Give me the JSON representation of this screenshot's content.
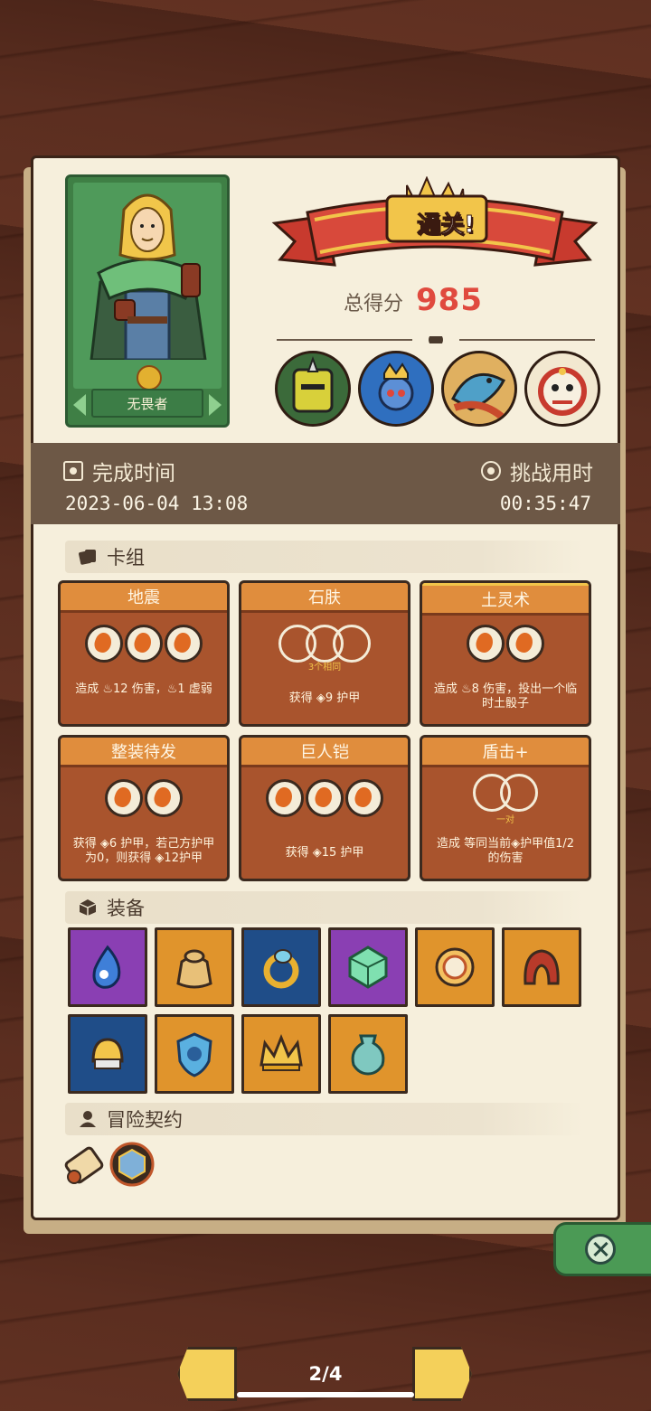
{
  "hero": {
    "name": "无畏者"
  },
  "result": {
    "banner": "通关!",
    "score_label": "总得分",
    "score_value": "985"
  },
  "time": {
    "complete_label": "完成时间",
    "complete_value": "2023-06-04  13:08",
    "challenge_label": "挑战用时",
    "challenge_value": "00:35:47"
  },
  "sections": {
    "deck": "卡组",
    "equipment": "装备",
    "contracts": "冒险契约"
  },
  "cards": [
    {
      "title": "地震",
      "orbs": 3,
      "sub": "",
      "desc": "造成 ♨12 伤害，♨1 虚弱"
    },
    {
      "title": "石肤",
      "orbs": 3,
      "sub": "3个相同",
      "desc": "获得 ◈9 护甲"
    },
    {
      "title": "土灵术",
      "orbs": 2,
      "sub": "",
      "desc": "造成 ♨8 伤害，投出一个临时土骰子"
    },
    {
      "title": "整装待发",
      "orbs": 2,
      "sub": "",
      "desc": "获得 ◈6 护甲，若己方护甲为0，则获得 ◈12护甲"
    },
    {
      "title": "巨人铠",
      "orbs": 3,
      "sub": "",
      "desc": "获得 ◈15 护甲"
    },
    {
      "title": "盾击+",
      "orbs": 2,
      "sub": "一对",
      "desc": "造成 等同当前◈护甲值1/2 的伤害"
    }
  ],
  "equipment_icons": [
    "blue-flame-icon",
    "treasure-bag-icon",
    "gold-ring-icon",
    "green-gem-icon",
    "coin-disc-icon",
    "red-hood-icon",
    "gold-helmet-icon",
    "blue-shield-icon",
    "gold-crown-icon",
    "teal-vase-icon"
  ],
  "colors": {
    "score": "#e04a3e",
    "purple": "#8a3fb3",
    "orange": "#e0942c",
    "navy": "#1f4d88"
  },
  "pager": {
    "text": "2/4"
  }
}
